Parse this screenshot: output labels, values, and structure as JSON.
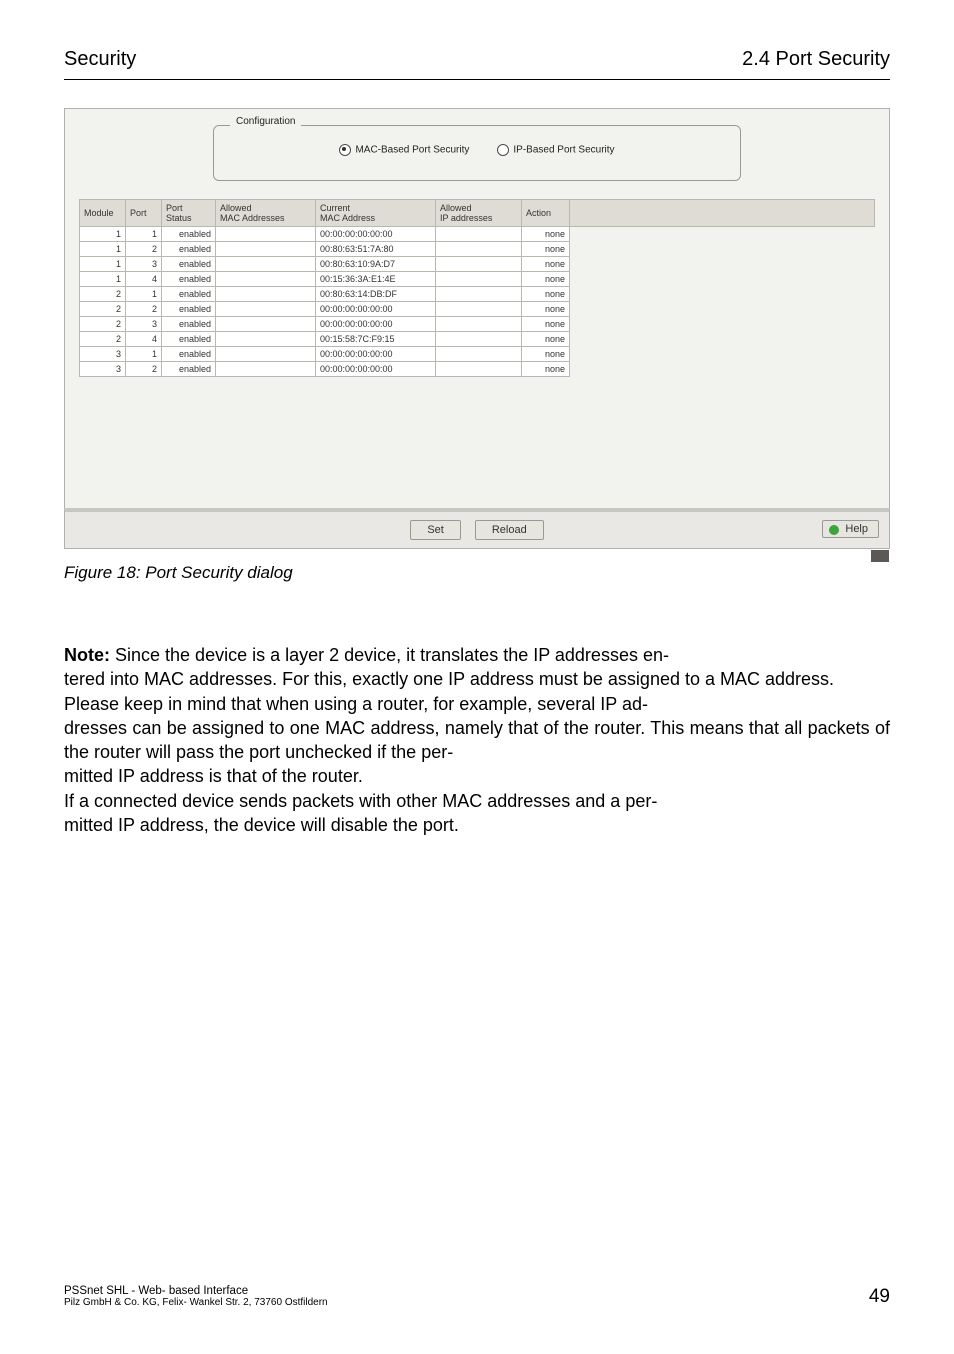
{
  "header": {
    "left": "Security",
    "right": "2.4  Port Security"
  },
  "dialog": {
    "cfg_legend": "Configuration",
    "radios": {
      "mac": {
        "label": "MAC-Based Port Security",
        "selected": true
      },
      "ip": {
        "label": "IP-Based Port Security",
        "selected": false
      }
    },
    "columns": {
      "module": "Module",
      "port": "Port",
      "port_status": "Port\nStatus",
      "allowed_mac": "Allowed\nMAC Addresses",
      "current_mac": "Current\nMAC Address",
      "allowed_ip": "Allowed\nIP addresses",
      "action": "Action"
    },
    "rows": [
      {
        "module": 1,
        "port": 1,
        "status": "enabled",
        "allowed_mac": "",
        "current_mac": "00:00:00:00:00:00",
        "allowed_ip": "",
        "action": "none"
      },
      {
        "module": 1,
        "port": 2,
        "status": "enabled",
        "allowed_mac": "",
        "current_mac": "00:80:63:51:7A:80",
        "allowed_ip": "",
        "action": "none"
      },
      {
        "module": 1,
        "port": 3,
        "status": "enabled",
        "allowed_mac": "",
        "current_mac": "00:80:63:10:9A:D7",
        "allowed_ip": "",
        "action": "none"
      },
      {
        "module": 1,
        "port": 4,
        "status": "enabled",
        "allowed_mac": "",
        "current_mac": "00:15:36:3A:E1:4E",
        "allowed_ip": "",
        "action": "none"
      },
      {
        "module": 2,
        "port": 1,
        "status": "enabled",
        "allowed_mac": "",
        "current_mac": "00:80:63:14:DB:DF",
        "allowed_ip": "",
        "action": "none"
      },
      {
        "module": 2,
        "port": 2,
        "status": "enabled",
        "allowed_mac": "",
        "current_mac": "00:00:00:00:00:00",
        "allowed_ip": "",
        "action": "none"
      },
      {
        "module": 2,
        "port": 3,
        "status": "enabled",
        "allowed_mac": "",
        "current_mac": "00:00:00:00:00:00",
        "allowed_ip": "",
        "action": "none"
      },
      {
        "module": 2,
        "port": 4,
        "status": "enabled",
        "allowed_mac": "",
        "current_mac": "00:15:58:7C:F9:15",
        "allowed_ip": "",
        "action": "none"
      },
      {
        "module": 3,
        "port": 1,
        "status": "enabled",
        "allowed_mac": "",
        "current_mac": "00:00:00:00:00:00",
        "allowed_ip": "",
        "action": "none"
      },
      {
        "module": 3,
        "port": 2,
        "status": "enabled",
        "allowed_mac": "",
        "current_mac": "00:00:00:00:00:00",
        "allowed_ip": "",
        "action": "none"
      }
    ],
    "buttons": {
      "set": "Set",
      "reload": "Reload",
      "help": "Help"
    }
  },
  "fig_caption": "Figure 18: Port Security dialog",
  "note": {
    "label": "Note:",
    "p1a": " Since the device is a layer 2 device, it translates the IP addresses en",
    "p1b": "tered into MAC addresses. For this, exactly one IP address must be assigned to a MAC address.",
    "p2a": "Please keep in mind that when using a router, for example, several IP ad",
    "p2b": "dresses can be assigned to one MAC address, namely that of the router. This means that all packets of the router will pass the port unchecked if the per",
    "p2c": "mitted IP address is that of the router.",
    "p3a": "If a connected device sends packets with other MAC addresses and a per",
    "p3b": "mitted IP address, the device will disable the port."
  },
  "footer": {
    "line1": "PSSnet SHL - Web- based Interface",
    "line2": "Pilz GmbH & Co. KG, Felix- Wankel Str. 2, 73760 Ostfildern",
    "page": "49"
  }
}
